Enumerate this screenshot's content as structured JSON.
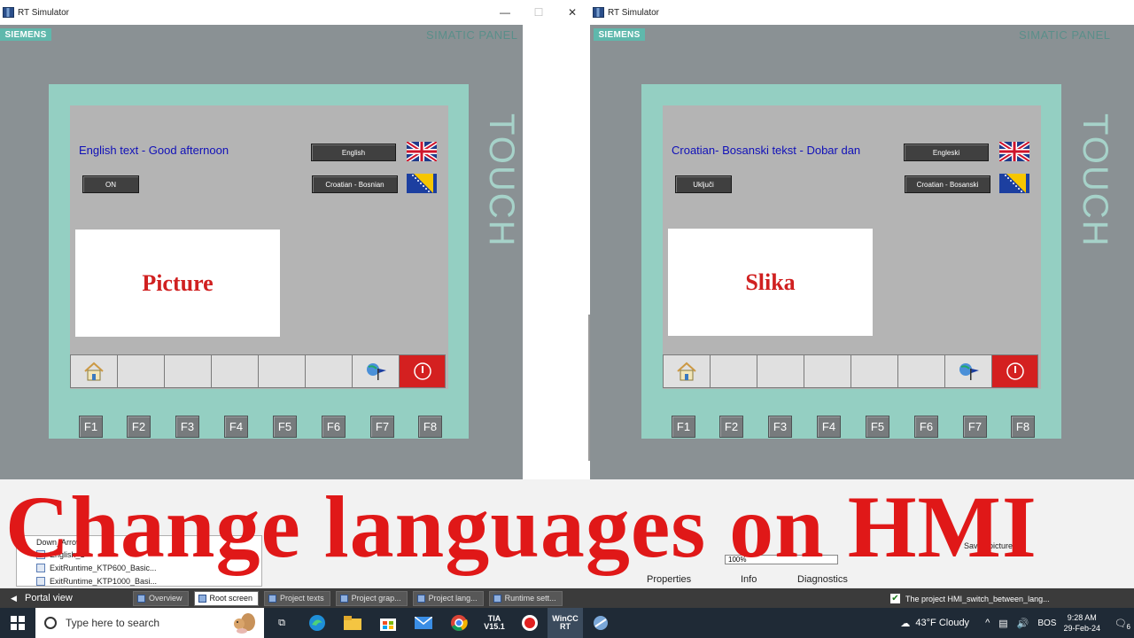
{
  "left_window": {
    "title": "RT Simulator",
    "brand": "SIEMENS",
    "panel_label": "SIMATIC PANEL",
    "touch_label": "TOUCH",
    "screen_text": "English text - Good afternoon",
    "btn_lang1": "English",
    "btn_lang2": "Croatian - Bosnian",
    "btn_on": "ON",
    "picture_label": "Picture"
  },
  "right_window": {
    "title": "RT Simulator",
    "brand": "SIEMENS",
    "panel_label": "SIMATIC PANEL",
    "touch_label": "TOUCH",
    "screen_text": "Croatian- Bosanski tekst - Dobar dan",
    "btn_lang1": "Engleski",
    "btn_lang2": "Croatian - Bosanski",
    "btn_on": "Uključi",
    "picture_label": "Slika"
  },
  "fkeys": [
    "F1",
    "F2",
    "F3",
    "F4",
    "F5",
    "F6",
    "F7",
    "F8"
  ],
  "window_controls": {
    "minimize": "—",
    "maximize": "☐",
    "close": "✕"
  },
  "overlay_title": "Change languages on HMI",
  "editor": {
    "tree_items": [
      "Down_Arrow",
      "English_1",
      "ExitRuntime_KTP600_Basic...",
      "ExitRuntime_KTP1000_Basi..."
    ],
    "zoom": "100%",
    "saved_picture": "Saved picture",
    "inspector_tabs": [
      "Properties",
      "Info",
      "Diagnostics"
    ]
  },
  "portal_bar": {
    "portal_view": "Portal view",
    "tabs": [
      "Overview",
      "Root screen",
      "Project texts",
      "Project grap...",
      "Project lang...",
      "Runtime sett..."
    ],
    "active_tab": 1,
    "status_message": "The project HMI_switch_between_lang..."
  },
  "taskbar": {
    "search_placeholder": "Type here to search",
    "weather": "43°F  Cloudy",
    "language": "BOS",
    "time": "9:28 AM",
    "date": "29-Feb-24",
    "notification_count": "6",
    "tia_label": "TIA V15.1",
    "wincc_label": "WinCC RT"
  },
  "colors": {
    "panel_gray": "#8a9194",
    "bezel_teal": "#94cfc2",
    "screen_gray": "#b4b4b4",
    "hmi_text_blue": "#1010b8",
    "picture_red": "#d02020",
    "overlay_red": "#e01818",
    "siemens_teal": "#5fb8ac"
  }
}
